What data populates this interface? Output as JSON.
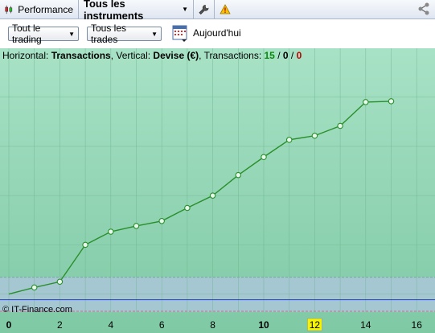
{
  "tabs": {
    "performance": "Performance",
    "instruments": "Tous les instruments"
  },
  "toolbar": {
    "trading_filter": "Tout le trading",
    "trades_filter": "Tous les trades",
    "today_label": "Aujourd'hui"
  },
  "info": {
    "horizontal_prefix": "Horizontal: ",
    "horizontal_value": "Transactions",
    "vertical_prefix": ", Vertical: ",
    "vertical_value": "Devise (€)",
    "transactions_prefix": ", Transactions: ",
    "wins": "15",
    "sep1": " / ",
    "neutral": "0",
    "sep2": " / ",
    "losses": "0"
  },
  "copyright": "© IT-Finance.com",
  "colors": {
    "plot_bg_top": "#a8e2c6",
    "plot_bg_bottom": "#7fc9a5",
    "band_bg": "#a9c6d6",
    "line": "#2a8f2a",
    "baseline": "#2a3ccc",
    "highlight_tick_bg": "#f4f400"
  },
  "chart_data": {
    "type": "line",
    "x_ticks": [
      {
        "label": "0",
        "bold": true
      },
      {
        "label": "2"
      },
      {
        "label": "4"
      },
      {
        "label": "6"
      },
      {
        "label": "8"
      },
      {
        "label": "10",
        "bold": true
      },
      {
        "label": "12",
        "highlight": true
      },
      {
        "label": "14"
      },
      {
        "label": "16"
      }
    ],
    "x": [
      0,
      1,
      2,
      3,
      4,
      5,
      6,
      7,
      8,
      9,
      10,
      11,
      12,
      13,
      14,
      15
    ],
    "y": [
      0,
      4,
      7.5,
      30,
      38,
      41.5,
      44.5,
      52.5,
      60,
      72.5,
      83.5,
      94,
      96.5,
      102.5,
      117,
      117.5
    ],
    "xlim": [
      0,
      16.8
    ],
    "ylim": [
      -11,
      140
    ],
    "grid": true
  }
}
